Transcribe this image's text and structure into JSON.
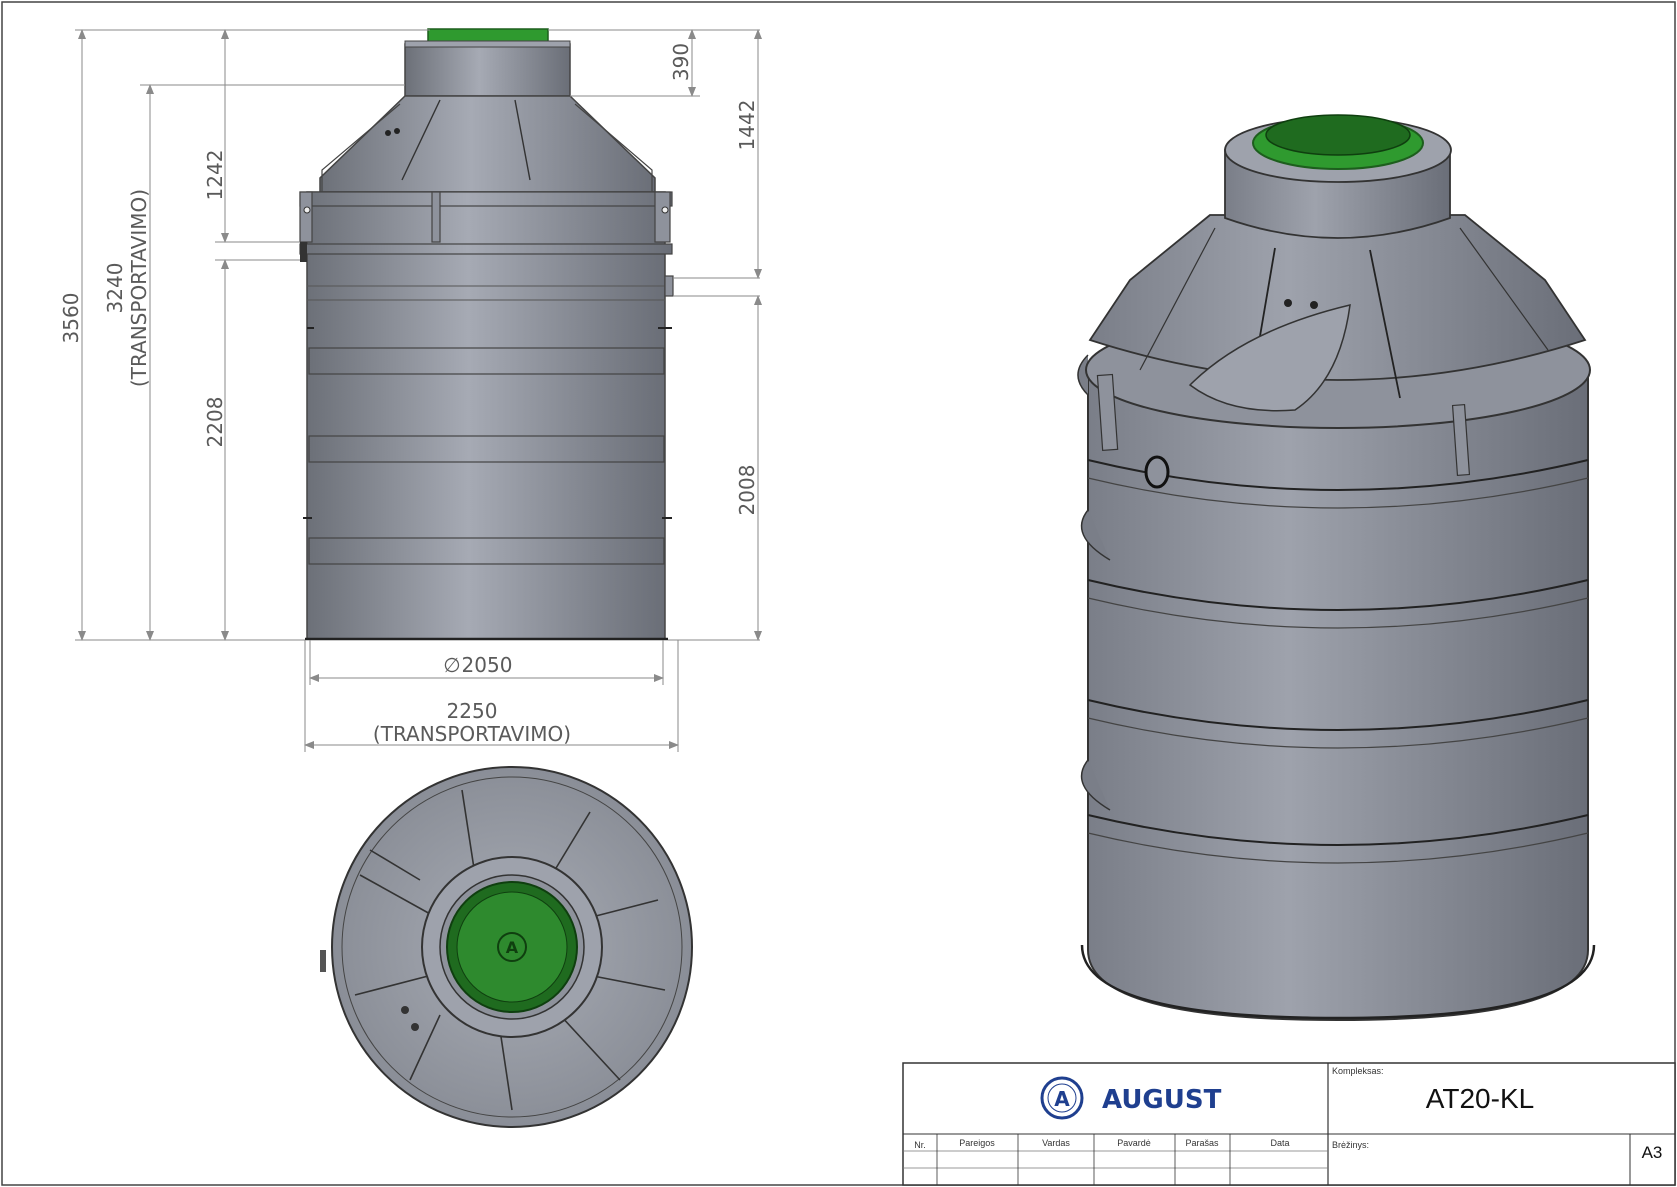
{
  "dimensions": {
    "overall_height": "3560",
    "transport_height": "3240",
    "transport_height_note": "(TRANSPORTAVIMO)",
    "top_to_inlet": "1242",
    "riser_height": "390",
    "top_to_outlet": "1442",
    "inlet_height": "2208",
    "outlet_height": "2008",
    "diameter": "2050",
    "diameter_symbol": "∅",
    "transport_width": "2250",
    "transport_width_note": "(TRANSPORTAVIMO)"
  },
  "title_block": {
    "logo_text": "AUGUST",
    "logo_mark": "A",
    "complex_label": "Kompleksas:",
    "complex_value": "AT20-KL",
    "drawing_label": "Brėžinys:",
    "sheet_size": "A3",
    "columns": [
      "Nr.",
      "Pareigos",
      "Vardas",
      "Pavardė",
      "Parašas",
      "Data"
    ]
  },
  "colors": {
    "tank_body": "#8e929c",
    "tank_dark": "#5f636c",
    "lid_green": "#2f9a2f",
    "brand_blue": "#1f3f8f",
    "dim_line": "#8a8a8a"
  }
}
